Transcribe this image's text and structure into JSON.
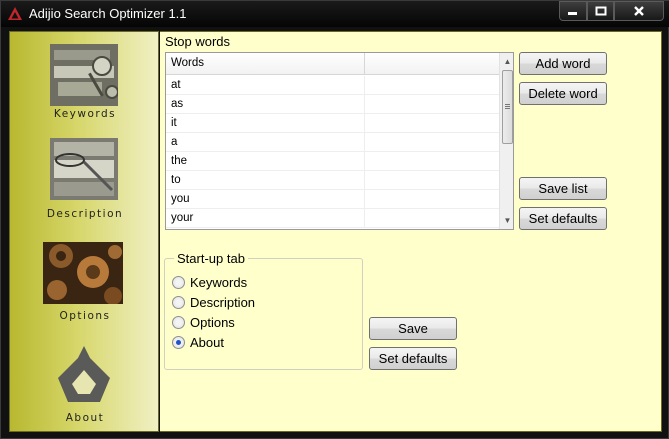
{
  "window": {
    "title": "Adijio Search Optimizer 1.1",
    "controls": {
      "minimize": "minimize-icon",
      "maximize": "maximize-icon",
      "close": "close-icon"
    }
  },
  "sidebar": {
    "items": [
      {
        "label": "Keywords",
        "icon": "keys-icon"
      },
      {
        "label": "Description",
        "icon": "magnifier-icon"
      },
      {
        "label": "Options",
        "icon": "gears-icon"
      },
      {
        "label": "About",
        "icon": "adijio-logo-icon"
      }
    ]
  },
  "stop_words": {
    "title": "Stop words",
    "column_header": "Words",
    "rows": [
      "at",
      "as",
      "it",
      "a",
      "the",
      "to",
      "you",
      "your"
    ],
    "buttons": {
      "add": "Add word",
      "delete": "Delete word",
      "save_list": "Save list",
      "set_defaults": "Set defaults"
    }
  },
  "startup_tab": {
    "title": "Start-up tab",
    "options": [
      "Keywords",
      "Description",
      "Options",
      "About"
    ],
    "selected": "About"
  },
  "bottom_buttons": {
    "save": "Save",
    "set_defaults": "Set defaults"
  },
  "colors": {
    "panel_bg": "#ffffcc",
    "sidebar_accent": "#b8b830",
    "title_bar": "#0a0a0a",
    "radio_selected": "#1d54c7"
  }
}
